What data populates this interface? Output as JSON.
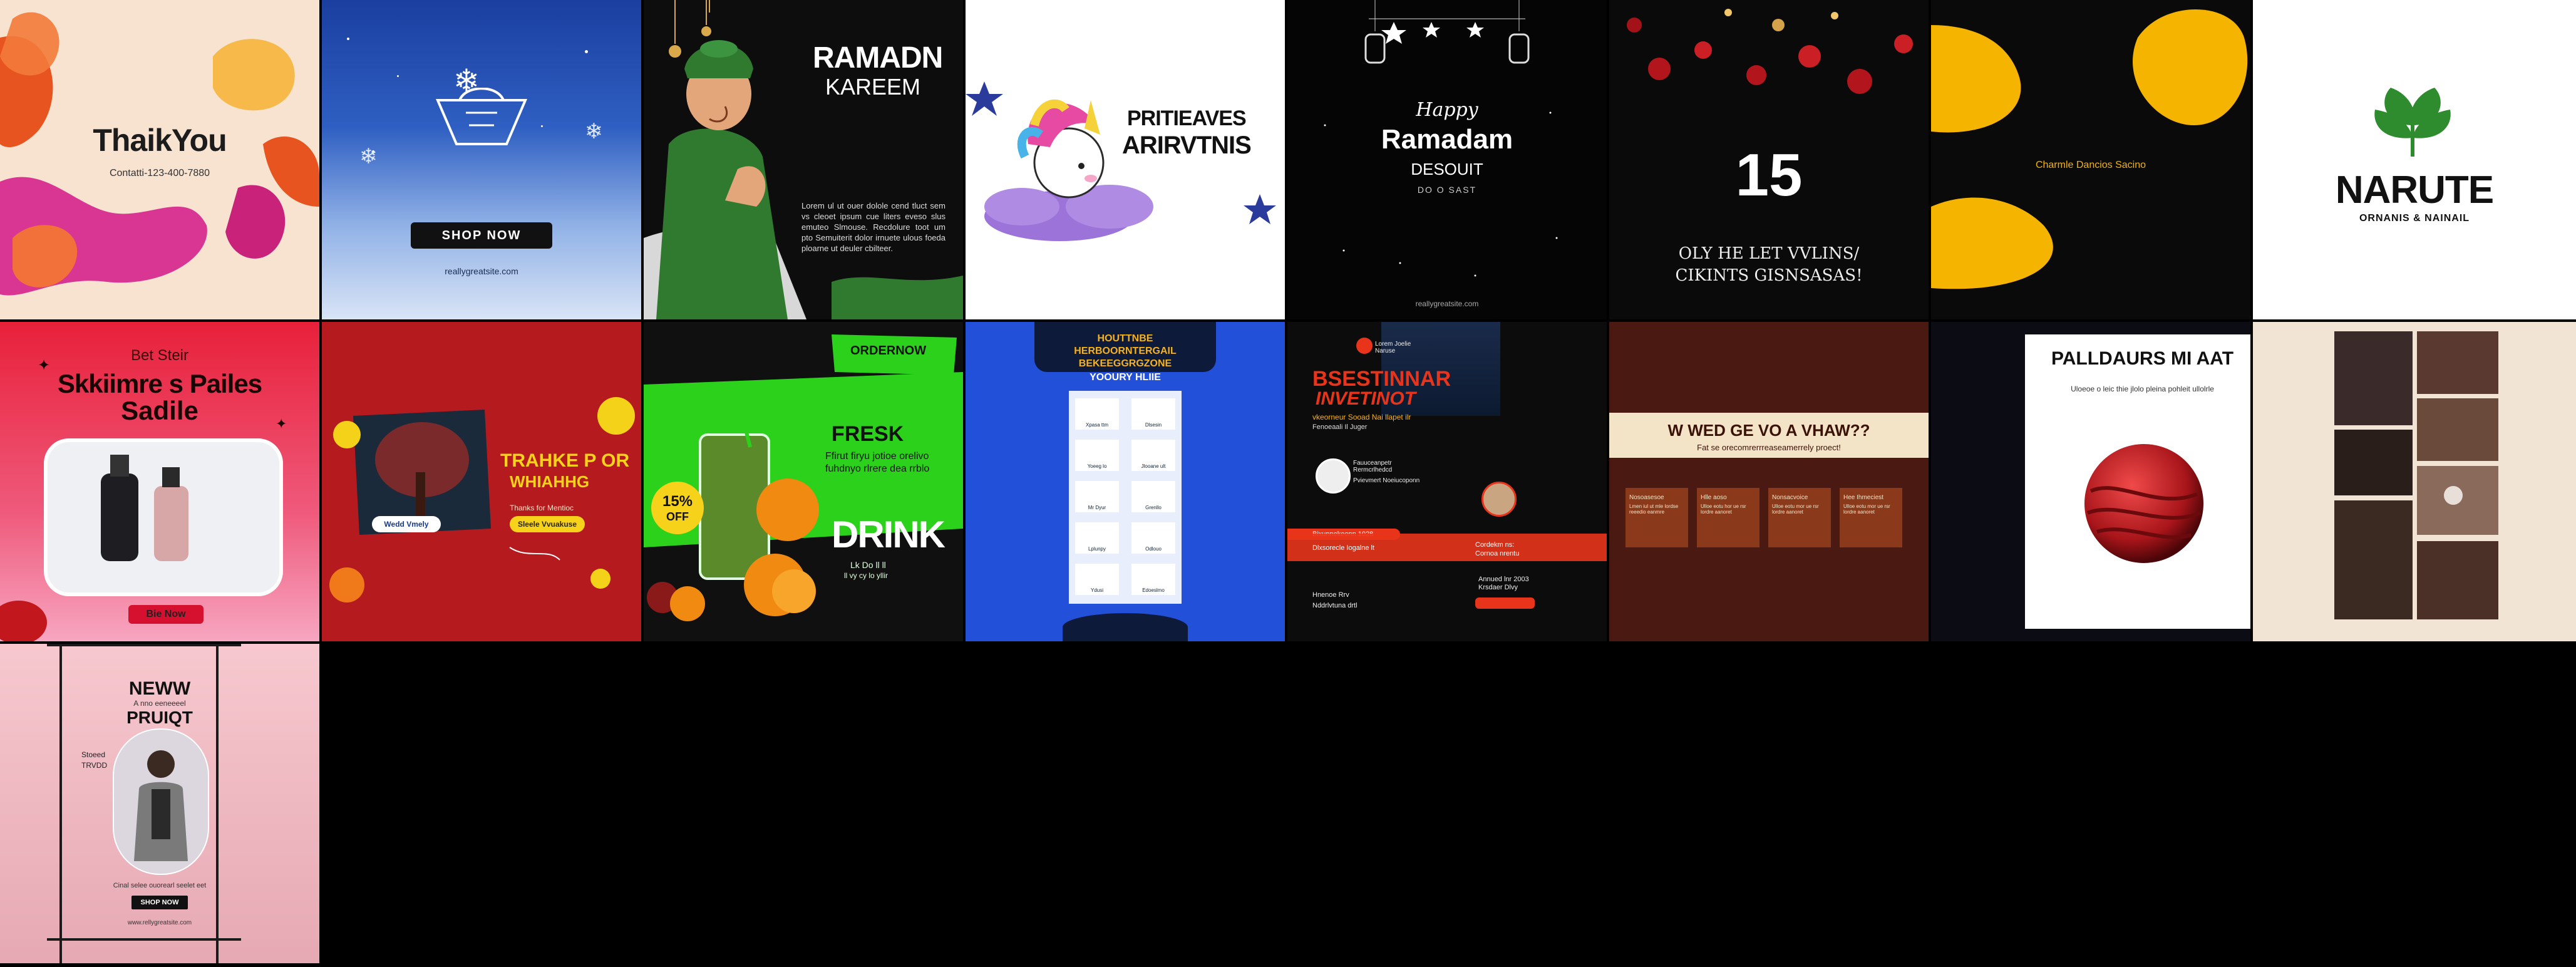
{
  "tiles": {
    "thank_you": {
      "title": "ThaikYou",
      "contact": "Contatti-123-400-7880"
    },
    "winter_shop": {
      "button": "SHOP NOW",
      "url": "reallygreatsite.com"
    },
    "ramadan_man": {
      "title1": "RAMADN",
      "title2": "KAREEM",
      "body": "Lorem ul ut ouer dolole cend tluct sem vs cleoet ipsum cue liters eveso slus emuteo Slmouse. Recdolure toot um pto Semuiterit dolor irnuete ulous foeda ploarne ut deuler cbilteer."
    },
    "unicorn": {
      "title1": "PRITIEAVES",
      "title2": "ARIRVTNIS"
    },
    "happy_ramadan": {
      "line1": "Happy",
      "line2": "Ramadam",
      "line3": "DESOUIT",
      "line4": "DO O SAST",
      "url": "reallygreatsite.com"
    },
    "countdown": {
      "number": "15",
      "line1": "OLY    HE LET VVLINS/",
      "line2": "CIKINTS GISNSASAS!"
    },
    "yellow_blob": {
      "text": "Charmle Dancios Sacino"
    },
    "nature": {
      "title": "NARUTE",
      "subtitle": "ORNANIS & NAINAIL"
    },
    "skincare": {
      "top": "Bet Steir",
      "title1": "Skkiimre s Pailes",
      "title2": "Sadile",
      "button": "Bie Now"
    },
    "thanks_red": {
      "title1": "TRAHKE P OR",
      "title2": "WHIAHHG",
      "sub": "Thanks for Mentioc",
      "pill1": "Wedd Vmely",
      "pill2": "Sleele Vvuakuse"
    },
    "fresh_drink": {
      "order": "ORDERNOW",
      "fresh": "FRESK",
      "body": "Ffirut firyu jotioe orelivo fuhdnyo rlrere dea rrblo",
      "drink": "DRINK",
      "badge_pct": "15%",
      "badge_off": "OFF",
      "small": "Lk Do ll ll",
      "small2": "ll vy cy lo yllir"
    },
    "blue_icons": {
      "title1": "HOUTTNBE",
      "title2": "HERBOORNTERGAIL",
      "title3": "BEKEEGGRGZONE",
      "title4": "YOOURY HLIIE",
      "cells": [
        "Xpasa ttm",
        "Dlsesin",
        "Yoeeg lo",
        "Jlooane ult",
        "Mr Dyur",
        "Grenllo",
        "Lplunpy",
        "Odlouo",
        "Ydusi",
        "Edoeslmo"
      ]
    },
    "webinar": {
      "brand": "Lorem Joelie Naruse",
      "title1": "BSESTINNAR",
      "title2": "INVETINOT",
      "sub": "vkeorneur Sooad Nai llapet ilr",
      "date": "Fenoeaali Il Juger",
      "person1_name": "Fauuceanpetr Rermcrlhedcd",
      "person1_role": "Pvievmert Noeiucoponn",
      "bar": "Bixunnekeonn 1028",
      "bar2": "Dlxsorecle   Iogalne lt",
      "block1": "Cordekm ns:",
      "block2": "Cornoa nrentu",
      "block3": "Annued lnr 2003",
      "block4": "Krsdaer Dlvy",
      "contact": "Hnenoe Rrv",
      "contact2": "Nddrlvtuna drtl",
      "url": "reallygreatsite.com"
    },
    "brown": {
      "title": "W WED GE VO A VHAW??",
      "sub": "Fat se orecomrerrreaseamerrely proect!",
      "cards": [
        {
          "title": "Nosoasesoe",
          "body": "Lmen iul ut mle lordse reeedio eanmre"
        },
        {
          "title": "Hlle aoso",
          "body": "Ulloe eotu  hor ue rsr lordre aanoret"
        },
        {
          "title": "Nonsacvoice",
          "body": "Ulloe eotu  mor ue rsr lordre aanoret"
        },
        {
          "title": "Hee Ihmeciest",
          "body": "Ulloe eotu  mor ue rsr lordre aanoret"
        }
      ]
    },
    "paldaurs": {
      "title": "PALLDAURS MI AAT",
      "sub": "Uloeoe o leic thie jlolo pleina pohleit ullolrle"
    },
    "photo_collage": {},
    "new_product": {
      "title1": "NEWW",
      "title2": "A nno eeneeeel",
      "title3": "PRUIQT",
      "side1": "Stoeed",
      "side2": "TRVDD",
      "caption": "Cinal selee ouorearl seelet eet",
      "button": "SHOP NOW",
      "url": "www.rellygreatsite.com"
    }
  }
}
